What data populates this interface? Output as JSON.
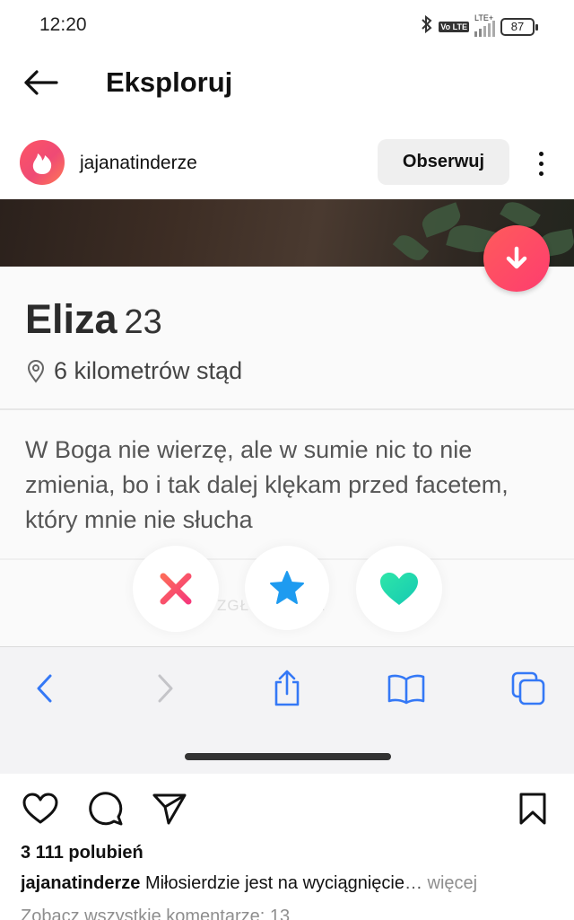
{
  "status_bar": {
    "time": "12:20",
    "volte_label": "Vo LTE",
    "network_label": "LTE+",
    "battery": "87",
    "icons": [
      "bluetooth-icon",
      "volte-icon",
      "signal-icon",
      "battery-icon"
    ]
  },
  "top_bar": {
    "title": "Eksploruj",
    "back_icon": "arrow-left-icon"
  },
  "post": {
    "username": "jajanatinderze",
    "follow_label": "Obserwuj",
    "more_icon": "more-vertical-icon"
  },
  "profile_card": {
    "name": "Eliza",
    "age": "23",
    "distance": "6 kilometrów stąd",
    "bio": "W Boga nie wierzę, ale w sumie nic to nie zmienia, bo i tak dalej klękam przed facetem, który mnie nie słucha",
    "report_label": "ZGŁOŚ ELIZA",
    "action_icons": [
      "nope-x-icon",
      "super-like-star-icon",
      "like-heart-icon"
    ],
    "colors": {
      "nope": "#f7456a",
      "star": "#1e9bf0",
      "like": "#1ed9a6",
      "accent": "#fd4d63"
    }
  },
  "browser_bar": {
    "icons": [
      "back-chevron-icon",
      "forward-chevron-icon",
      "share-icon",
      "bookmarks-icon",
      "tabs-icon"
    ]
  },
  "post_footer": {
    "likes": "3 111 polubień",
    "caption_user": "jajanatinderze",
    "caption_text": "Miłosierdzie jest na wyciągnięcie",
    "caption_ellipsis": "…",
    "caption_more": "więcej",
    "comments_link": "Zobacz wszystkie komentarze: 13"
  }
}
